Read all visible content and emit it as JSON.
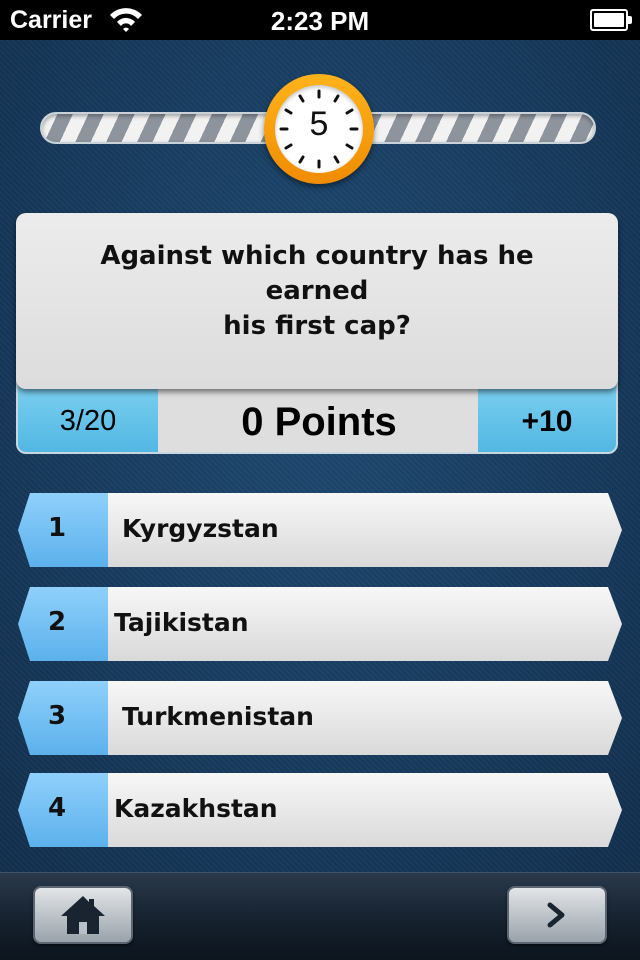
{
  "status_bar": {
    "carrier": "Carrier",
    "time": "2:23 PM",
    "wifi_icon": "wifi-icon",
    "battery_icon": "battery-icon"
  },
  "timer": {
    "seconds_left": "5",
    "icon": "clock-icon",
    "accent_color": "#f5a000"
  },
  "question": {
    "text_line1": "Against which country has he earned",
    "text_line2": "his first cap?"
  },
  "score": {
    "progress": "3/20",
    "points": "0 Points",
    "bonus": "+10",
    "accent_color": "#5ec0ea"
  },
  "answers": [
    {
      "number": "1",
      "label": "Kyrgyzstan"
    },
    {
      "number": "2",
      "label": "Tajikistan"
    },
    {
      "number": "3",
      "label": "Turkmenistan"
    },
    {
      "number": "4",
      "label": "Kazakhstan"
    }
  ],
  "toolbar": {
    "home_icon": "home-icon",
    "next_icon": "chevron-right-icon"
  }
}
